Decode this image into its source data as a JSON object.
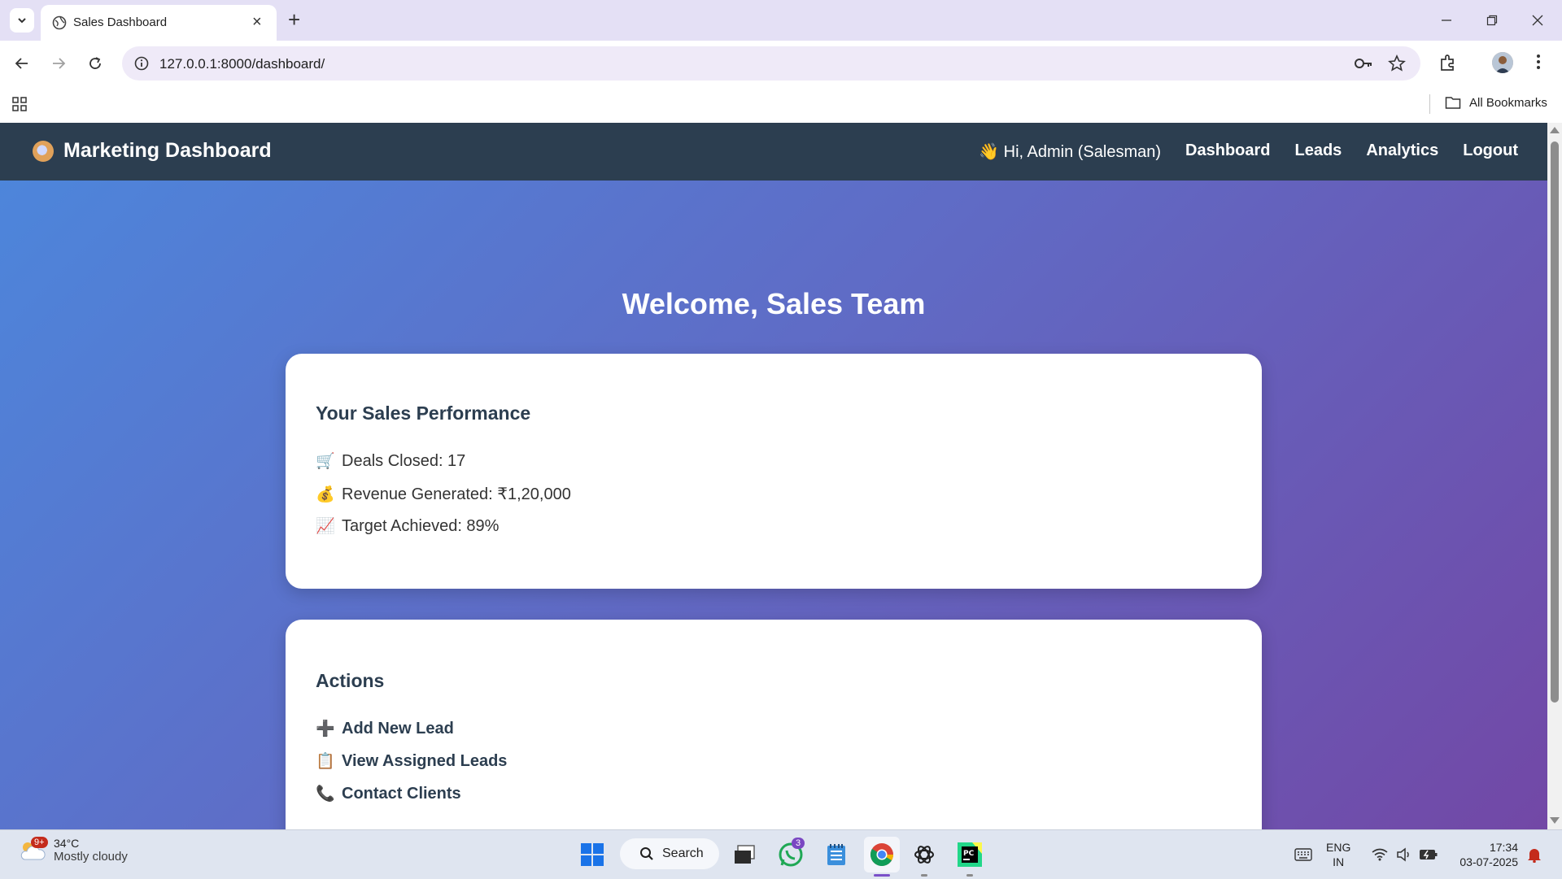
{
  "browser": {
    "tab_title": "Sales Dashboard",
    "url": "127.0.0.1:8000/dashboard/",
    "bookmarks_label": "All Bookmarks"
  },
  "app": {
    "brand": "Marketing Dashboard",
    "brand_icon": "compass-icon",
    "greeting": "👋 Hi, Admin (Salesman)",
    "nav": [
      "Dashboard",
      "Leads",
      "Analytics",
      "Logout"
    ],
    "welcome": "Welcome, Sales Team"
  },
  "performance": {
    "title": "Your Sales Performance",
    "items": [
      {
        "icon": "🛒",
        "text": "Deals Closed: 17"
      },
      {
        "icon": "💰",
        "text": "Revenue Generated: ₹1,20,000"
      },
      {
        "icon": "📈",
        "text": "Target Achieved: 89%"
      }
    ]
  },
  "actions": {
    "title": "Actions",
    "items": [
      {
        "icon": "➕",
        "text": "Add New Lead"
      },
      {
        "icon": "📋",
        "text": "View Assigned Leads"
      },
      {
        "icon": "📞",
        "text": "Contact Clients"
      }
    ]
  },
  "taskbar": {
    "weather_badge": "9+",
    "temperature": "34°C",
    "condition": "Mostly cloudy",
    "search_label": "Search",
    "whatsapp_badge": "3",
    "lang_line1": "ENG",
    "lang_line2": "IN",
    "time": "17:34",
    "date": "03-07-2025"
  },
  "colors": {
    "navbar": "#2c3e50",
    "gradient_start": "#4c87dc",
    "gradient_end": "#7248a6",
    "card": "#ffffff",
    "heading": "#2c3e50"
  }
}
